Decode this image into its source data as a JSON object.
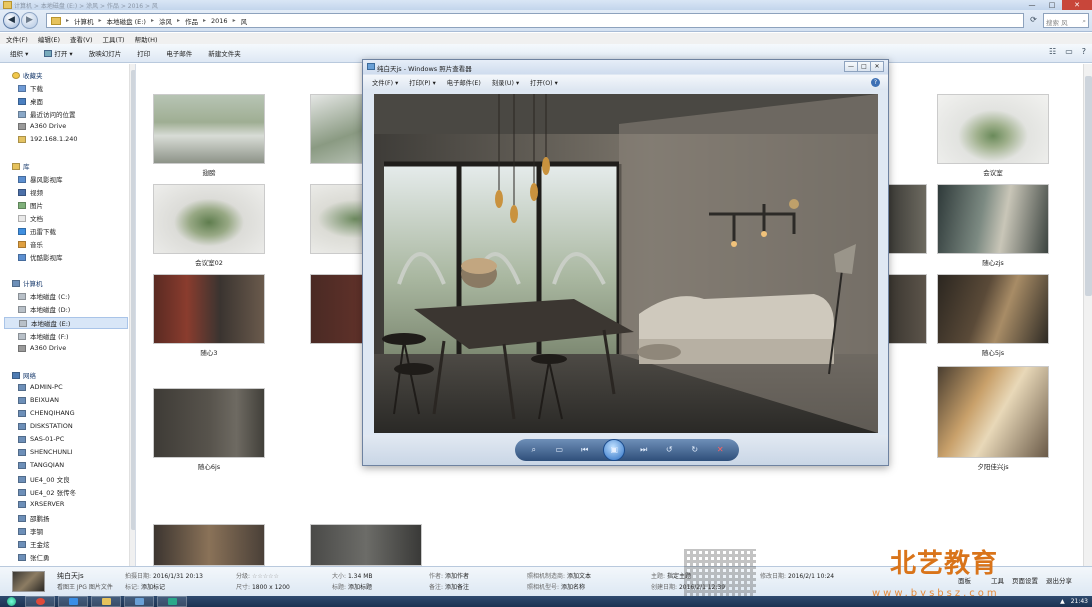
{
  "window": {
    "title": "计算机 > 本地磁盘 (E:) > 涂风 > 作品 > 2016 > 风"
  },
  "nav": {
    "back_icon": "back-arrow-icon",
    "forward_icon": "forward-arrow-icon",
    "breadcrumb": [
      "计算机",
      "本地磁盘 (E:)",
      "涂风",
      "作品",
      "2016",
      "风"
    ],
    "search_placeholder": "搜索 风"
  },
  "menu": [
    "文件(F)",
    "编辑(E)",
    "查看(V)",
    "工具(T)",
    "帮助(H)"
  ],
  "toolbar": {
    "organize": "组织 ▾",
    "open": "打开 ▾",
    "slideshow": "放映幻灯片",
    "print": "打印",
    "email": "电子邮件",
    "new_folder": "新建文件夹"
  },
  "sidebar": {
    "favorites": {
      "label": "收藏夹",
      "items": [
        "下载",
        "桌面",
        "最近访问的位置",
        "A360 Drive",
        "192.168.1.240"
      ]
    },
    "libraries": {
      "label": "库",
      "items": [
        "暴风影视库",
        "视频",
        "图片",
        "文档",
        "迅雷下载",
        "音乐",
        "优酷影视库"
      ]
    },
    "computer": {
      "label": "计算机",
      "items": [
        "本地磁盘 (C:)",
        "本地磁盘 (D:)",
        "本地磁盘 (E:)",
        "本地磁盘 (F:)",
        "A360 Drive"
      ]
    },
    "network": {
      "label": "网络",
      "items": [
        "ADMIN-PC",
        "BEIXUAN",
        "CHENQIHANG",
        "DISKSTATION",
        "SAS-01-PC",
        "SHENCHUNLI",
        "TANGQIAN",
        "UE4_00 文良",
        "UE4_02 张传冬",
        "XRSERVER",
        "邵鹏扬",
        "李钢",
        "王金炫",
        "张仁勇"
      ]
    }
  },
  "thumbnails": [
    {
      "caption": "翅膀"
    },
    {
      "caption": ""
    },
    {
      "caption": "会议室"
    },
    {
      "caption": "会议室02"
    },
    {
      "caption": ""
    },
    {
      "caption": ""
    },
    {
      "caption": "随心zjs"
    },
    {
      "caption": "随心3"
    },
    {
      "caption": ""
    },
    {
      "caption": ""
    },
    {
      "caption": "随心5js"
    },
    {
      "caption": "随心6js"
    },
    {
      "caption": "夕阳佳兴js"
    },
    {
      "caption": ""
    },
    {
      "caption": ""
    }
  ],
  "viewer": {
    "title": "纯白天js - Windows 照片查看器",
    "menu": [
      "文件(F) ▾",
      "打印(P) ▾",
      "电子邮件(E)",
      "刻录(U) ▾",
      "打开(O) ▾"
    ],
    "help": "?",
    "controls": [
      "zoom-icon",
      "actual-size-icon",
      "previous-icon",
      "slideshow-icon",
      "next-icon",
      "rotate-left-icon",
      "rotate-right-icon",
      "delete-icon"
    ]
  },
  "details": {
    "name": "纯白天js",
    "type": "看图王 JPG 图片文件",
    "date_taken_label": "拍摄日期:",
    "date_taken": "2016/1/31 20:13",
    "tags_label": "标记:",
    "tags": "添加标记",
    "rating_label": "分级:",
    "rating": "☆☆☆☆☆",
    "dimensions_label": "尺寸:",
    "dimensions": "1800 x 1200",
    "size_label": "大小:",
    "size": "1.34 MB",
    "title_label": "标题:",
    "title": "添加标题",
    "author_label": "作者:",
    "author": "添加作者",
    "comment_label": "备注:",
    "comment": "添加备注",
    "camera_maker_label": "照相机制造商:",
    "camera_maker": "添加文本",
    "camera_model_label": "照相机型号:",
    "camera_model": "添加名称",
    "subject_label": "主题:",
    "subject": "指定主题",
    "created_label": "创建日期:",
    "created": "2016/2/1 12:39",
    "modified_label": "修改日期:",
    "modified": "2016/2/1 10:24"
  },
  "bottom_right": {
    "view": "面板",
    "tools": "工具",
    "page_setup": "页面设置",
    "exit_share": "退出分享"
  },
  "brand": {
    "name": "北艺教育",
    "url": "www.bysbsz.com"
  },
  "taskbar": {
    "time": "21:43"
  },
  "colors": {
    "accent": "#2b6fc4",
    "brand_orange": "#d9741a",
    "close_red": "#c8463a"
  }
}
